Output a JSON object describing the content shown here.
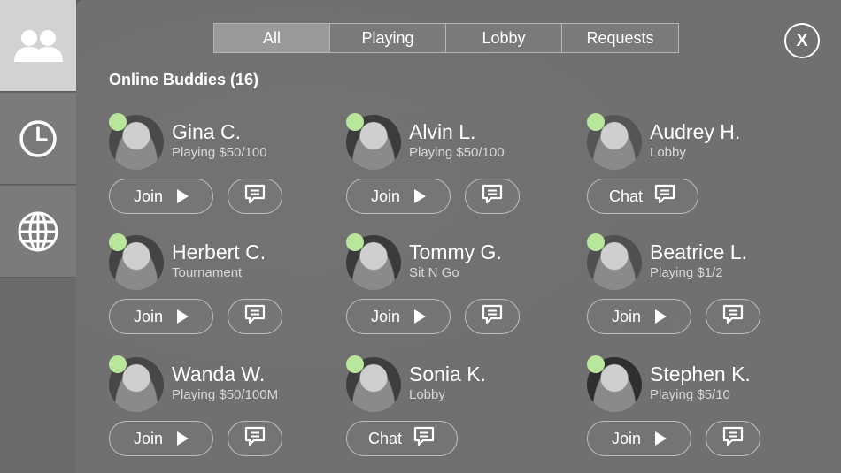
{
  "sidebar": {
    "items": [
      {
        "icon": "buddies-icon",
        "active": true
      },
      {
        "icon": "clock-icon",
        "active": false
      },
      {
        "icon": "globe-icon",
        "active": false
      }
    ]
  },
  "tabs": [
    {
      "label": "All",
      "active": true
    },
    {
      "label": "Playing",
      "active": false
    },
    {
      "label": "Lobby",
      "active": false
    },
    {
      "label": "Requests",
      "active": false
    }
  ],
  "close_label": "X",
  "section_title": "Online Buddies (16)",
  "buttons": {
    "join": "Join",
    "chat": "Chat"
  },
  "buddies": [
    {
      "name": "Gina C.",
      "status": "Playing $50/100",
      "action": "join",
      "online": true
    },
    {
      "name": "Alvin L.",
      "status": "Playing $50/100",
      "action": "join",
      "online": true
    },
    {
      "name": "Audrey H.",
      "status": "Lobby",
      "action": "chat",
      "online": true
    },
    {
      "name": "Herbert C.",
      "status": "Tournament",
      "action": "join",
      "online": true
    },
    {
      "name": "Tommy G.",
      "status": "Sit N Go",
      "action": "join",
      "online": true
    },
    {
      "name": "Beatrice L.",
      "status": "Playing $1/2",
      "action": "join",
      "online": true
    },
    {
      "name": "Wanda W.",
      "status": "Playing $50/100M",
      "action": "join",
      "online": true
    },
    {
      "name": "Sonia K.",
      "status": "Lobby",
      "action": "chat",
      "online": true
    },
    {
      "name": "Stephen K.",
      "status": "Playing $5/10",
      "action": "join",
      "online": true
    }
  ],
  "colors": {
    "online_dot": "#b8e69a",
    "active_side": "#d2d2d2"
  }
}
